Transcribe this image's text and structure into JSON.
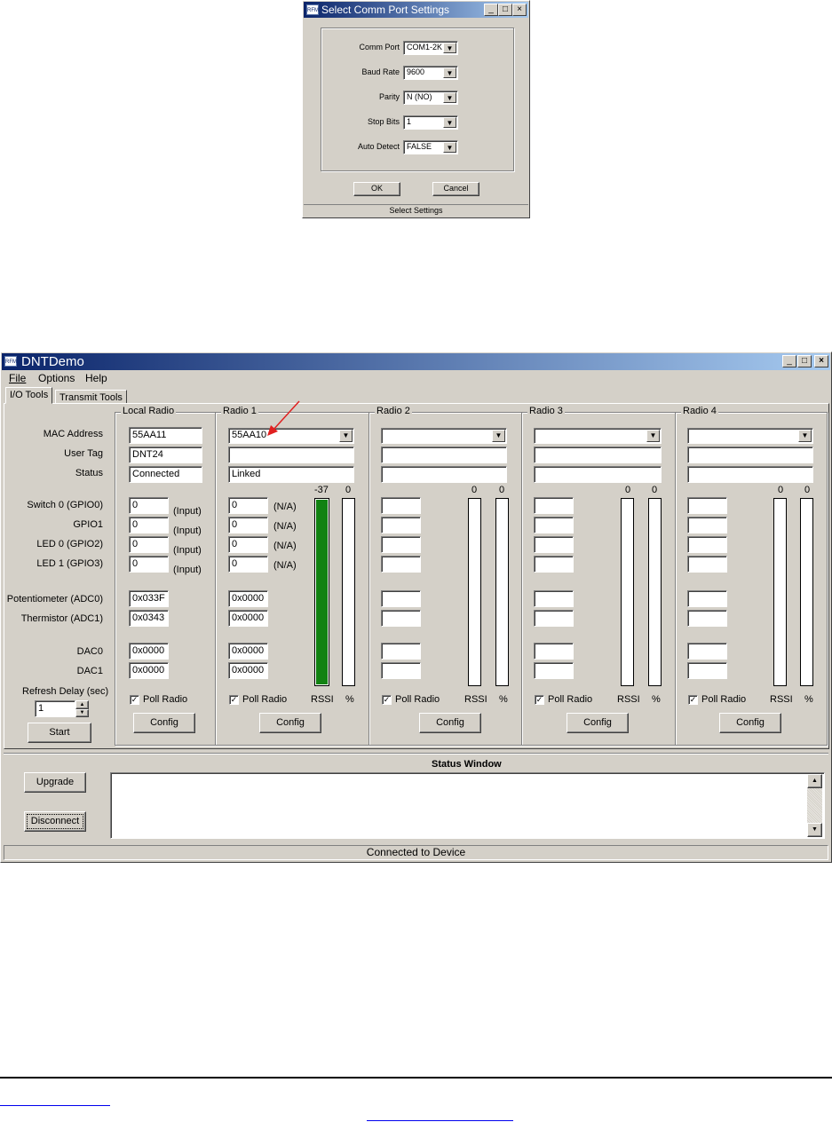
{
  "dialog": {
    "title": "Select Comm Port Settings",
    "rows": [
      {
        "label": "Comm Port",
        "value": "COM1-2K"
      },
      {
        "label": "Baud Rate",
        "value": "9600"
      },
      {
        "label": "Parity",
        "value": "N (NO)"
      },
      {
        "label": "Stop Bits",
        "value": "1"
      },
      {
        "label": "Auto Detect",
        "value": "FALSE"
      }
    ],
    "ok_label": "OK",
    "cancel_label": "Cancel",
    "status": "Select Settings"
  },
  "app": {
    "icon_text": "RFM",
    "title": "DNTDemo",
    "menu": [
      "File",
      "Options",
      "Help"
    ],
    "tabs": [
      "I/O Tools",
      "Transmit Tools"
    ],
    "row_labels": {
      "mac": "MAC Address",
      "user_tag": "User Tag",
      "status": "Status",
      "sw0": "Switch 0 (GPIO0)",
      "gpio1": "GPIO1",
      "led0": "LED 0 (GPIO2)",
      "led1": "LED 1 (GPIO3)",
      "adc0": "Potentiometer (ADC0)",
      "adc1": "Thermistor (ADC1)",
      "dac0": "DAC0",
      "dac1": "DAC1",
      "refresh": "Refresh Delay (sec)"
    },
    "refresh_value": "1",
    "start_label": "Start",
    "local": {
      "title": "Local Radio",
      "mac": "55AA11",
      "user_tag": "DNT24",
      "status": "Connected",
      "gpio": [
        "0",
        "0",
        "0",
        "0"
      ],
      "gpio_note": "(Input)",
      "adc0": "0x033F",
      "adc1": "0x0343",
      "dac0": "0x0000",
      "dac1": "0x0000",
      "poll": "Poll Radio",
      "config": "Config"
    },
    "radio1": {
      "title": "Radio 1",
      "mac": "55AA10",
      "user_tag": "",
      "status": "Linked",
      "gpio": [
        "0",
        "0",
        "0",
        "0"
      ],
      "gpio_note": "(N/A)",
      "adc0": "0x0000",
      "adc1": "0x0000",
      "dac0": "0x0000",
      "dac1": "0x0000",
      "rssi_value": "-37",
      "pct_value": "0",
      "rssi_fill_fraction": 1.0,
      "rssi_label": "RSSI",
      "pct_label": "%",
      "poll": "Poll Radio",
      "config": "Config"
    },
    "other_radios": [
      {
        "title": "Radio 2",
        "rssi_value": "0",
        "pct_value": "0",
        "rssi_label": "RSSI",
        "pct_label": "%",
        "poll": "Poll Radio",
        "config": "Config"
      },
      {
        "title": "Radio 3",
        "rssi_value": "0",
        "pct_value": "0",
        "rssi_label": "RSSI",
        "pct_label": "%",
        "poll": "Poll Radio",
        "config": "Config"
      },
      {
        "title": "Radio 4",
        "rssi_value": "0",
        "pct_value": "0",
        "rssi_label": "RSSI",
        "pct_label": "%",
        "poll": "Poll Radio",
        "config": "Config"
      }
    ],
    "upgrade_label": "Upgrade",
    "disconnect_label": "Disconnect",
    "status_window_title": "Status Window",
    "status_bar": "Connected to Device"
  },
  "colors": {
    "title_start": "#0a246a",
    "title_end": "#a6caf0",
    "rssi_fill": "#128212",
    "arrow": "#e02020",
    "face": "#d4d0c8"
  }
}
